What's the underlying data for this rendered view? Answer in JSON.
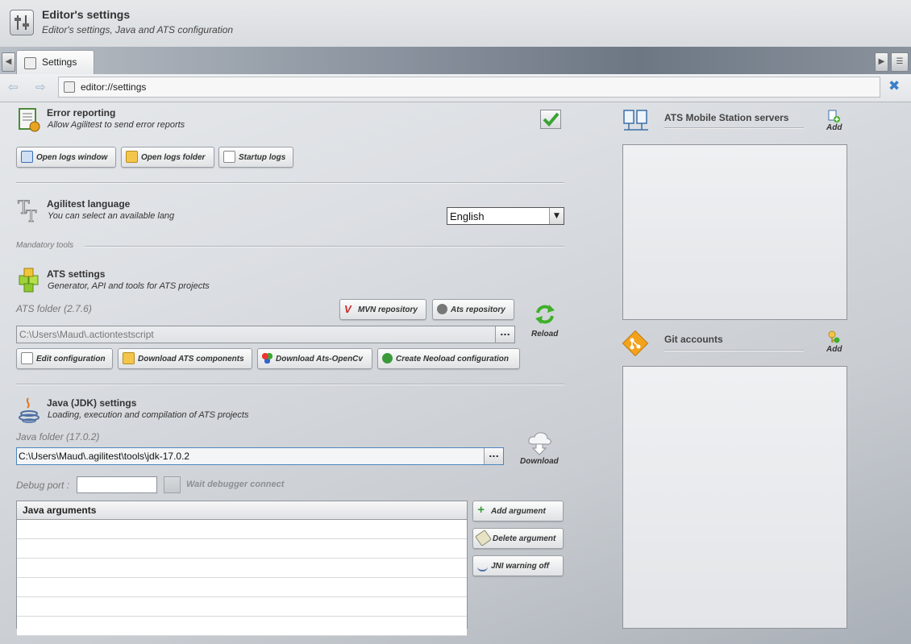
{
  "header": {
    "title": "Editor's settings",
    "subtitle": "Editor's settings, Java and ATS configuration"
  },
  "tabs": [
    {
      "label": "Settings",
      "active": true
    }
  ],
  "address": {
    "url": "editor://settings"
  },
  "error_reporting": {
    "title": "Error reporting",
    "subtitle": "Allow Agilitest to send error reports",
    "enabled": true,
    "buttons": {
      "open_logs_window": "Open logs window",
      "open_logs_folder": "Open logs folder",
      "startup_logs": "Startup logs"
    }
  },
  "language": {
    "title": "Agilitest language",
    "subtitle": "You can select an available lang",
    "selected": "English"
  },
  "mandatory_tools_label": "Mandatory tools",
  "ats": {
    "title": "ATS settings",
    "subtitle": "Generator, API and tools for ATS projects",
    "folder_label": "ATS folder (2.7.6)",
    "folder_value": "C:\\Users\\Maud\\.actiontestscript",
    "browse_label": "...",
    "mvn_repository": "MVN repository",
    "ats_repository": "Ats repository",
    "reload": "Reload",
    "buttons": {
      "edit_configuration": "Edit configuration",
      "download_components": "Download ATS components",
      "download_opencv": "Download Ats-OpenCv",
      "create_neoload": "Create Neoload configuration"
    }
  },
  "java": {
    "title": "Java (JDK) settings",
    "subtitle": "Loading, execution and compilation of ATS projects",
    "folder_label": "Java folder (17.0.2)",
    "folder_value": "C:\\Users\\Maud\\.agilitest\\tools\\jdk-17.0.2",
    "browse_label": "...",
    "download": "Download",
    "debug_port_label": "Debug port :",
    "debug_port_value": "",
    "wait_debugger_label": "Wait debugger connect",
    "wait_debugger_checked": false,
    "arguments_header": "Java arguments",
    "arguments": [
      "",
      "",
      "",
      "",
      "",
      ""
    ],
    "buttons": {
      "add_argument": "Add argument",
      "delete_argument": "Delete argument",
      "jni_warning_off": "JNI warning off"
    }
  },
  "mobile_servers": {
    "title": "ATS Mobile Station servers",
    "add_label": "Add"
  },
  "git_accounts": {
    "title": "Git accounts",
    "add_label": "Add"
  },
  "colors": {
    "accent": "#3a7fc8",
    "check": "#3aa335"
  }
}
